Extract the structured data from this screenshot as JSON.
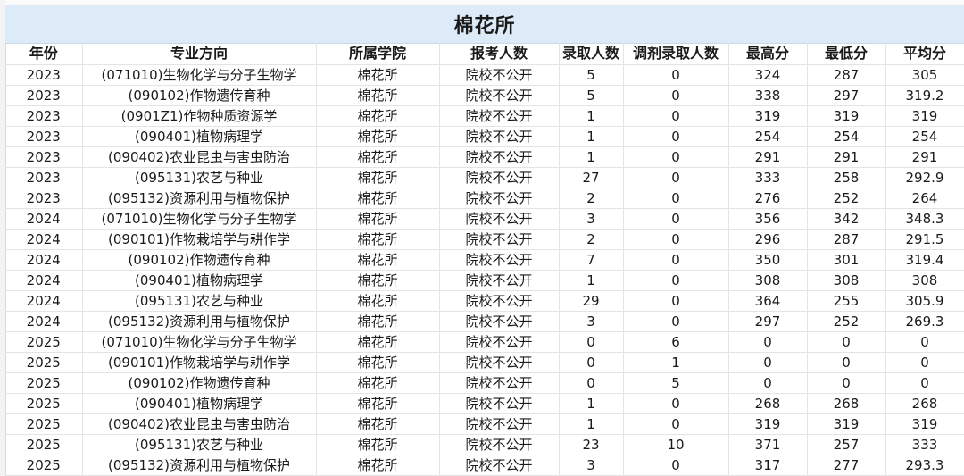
{
  "title": "棉花所",
  "headers": [
    "年份",
    "专业方向",
    "所属学院",
    "报考人数",
    "录取人数",
    "调剂录取人数",
    "最高分",
    "最低分",
    "平均分"
  ],
  "rows": [
    [
      "2023",
      "(071010)生物化学与分子生物学",
      "棉花所",
      "院校不公开",
      "5",
      "0",
      "324",
      "287",
      "305"
    ],
    [
      "2023",
      "(090102)作物遗传育种",
      "棉花所",
      "院校不公开",
      "5",
      "0",
      "338",
      "297",
      "319.2"
    ],
    [
      "2023",
      "(0901Z1)作物种质资源学",
      "棉花所",
      "院校不公开",
      "1",
      "0",
      "319",
      "319",
      "319"
    ],
    [
      "2023",
      "(090401)植物病理学",
      "棉花所",
      "院校不公开",
      "1",
      "0",
      "254",
      "254",
      "254"
    ],
    [
      "2023",
      "(090402)农业昆虫与害虫防治",
      "棉花所",
      "院校不公开",
      "1",
      "0",
      "291",
      "291",
      "291"
    ],
    [
      "2023",
      "(095131)农艺与种业",
      "棉花所",
      "院校不公开",
      "27",
      "0",
      "333",
      "258",
      "292.9"
    ],
    [
      "2023",
      "(095132)资源利用与植物保护",
      "棉花所",
      "院校不公开",
      "2",
      "0",
      "276",
      "252",
      "264"
    ],
    [
      "2024",
      "(071010)生物化学与分子生物学",
      "棉花所",
      "院校不公开",
      "3",
      "0",
      "356",
      "342",
      "348.3"
    ],
    [
      "2024",
      "(090101)作物栽培学与耕作学",
      "棉花所",
      "院校不公开",
      "2",
      "0",
      "296",
      "287",
      "291.5"
    ],
    [
      "2024",
      "(090102)作物遗传育种",
      "棉花所",
      "院校不公开",
      "7",
      "0",
      "350",
      "301",
      "319.4"
    ],
    [
      "2024",
      "(090401)植物病理学",
      "棉花所",
      "院校不公开",
      "1",
      "0",
      "308",
      "308",
      "308"
    ],
    [
      "2024",
      "(095131)农艺与种业",
      "棉花所",
      "院校不公开",
      "29",
      "0",
      "364",
      "255",
      "305.9"
    ],
    [
      "2024",
      "(095132)资源利用与植物保护",
      "棉花所",
      "院校不公开",
      "3",
      "0",
      "297",
      "252",
      "269.3"
    ],
    [
      "2025",
      "(071010)生物化学与分子生物学",
      "棉花所",
      "院校不公开",
      "0",
      "6",
      "0",
      "0",
      "0"
    ],
    [
      "2025",
      "(090101)作物栽培学与耕作学",
      "棉花所",
      "院校不公开",
      "0",
      "1",
      "0",
      "0",
      "0"
    ],
    [
      "2025",
      "(090102)作物遗传育种",
      "棉花所",
      "院校不公开",
      "0",
      "5",
      "0",
      "0",
      "0"
    ],
    [
      "2025",
      "(090401)植物病理学",
      "棉花所",
      "院校不公开",
      "1",
      "0",
      "268",
      "268",
      "268"
    ],
    [
      "2025",
      "(090402)农业昆虫与害虫防治",
      "棉花所",
      "院校不公开",
      "1",
      "0",
      "319",
      "319",
      "319"
    ],
    [
      "2025",
      "(095131)农艺与种业",
      "棉花所",
      "院校不公开",
      "23",
      "10",
      "371",
      "257",
      "333"
    ],
    [
      "2025",
      "(095132)资源利用与植物保护",
      "棉花所",
      "院校不公开",
      "3",
      "0",
      "317",
      "277",
      "293.3"
    ]
  ]
}
